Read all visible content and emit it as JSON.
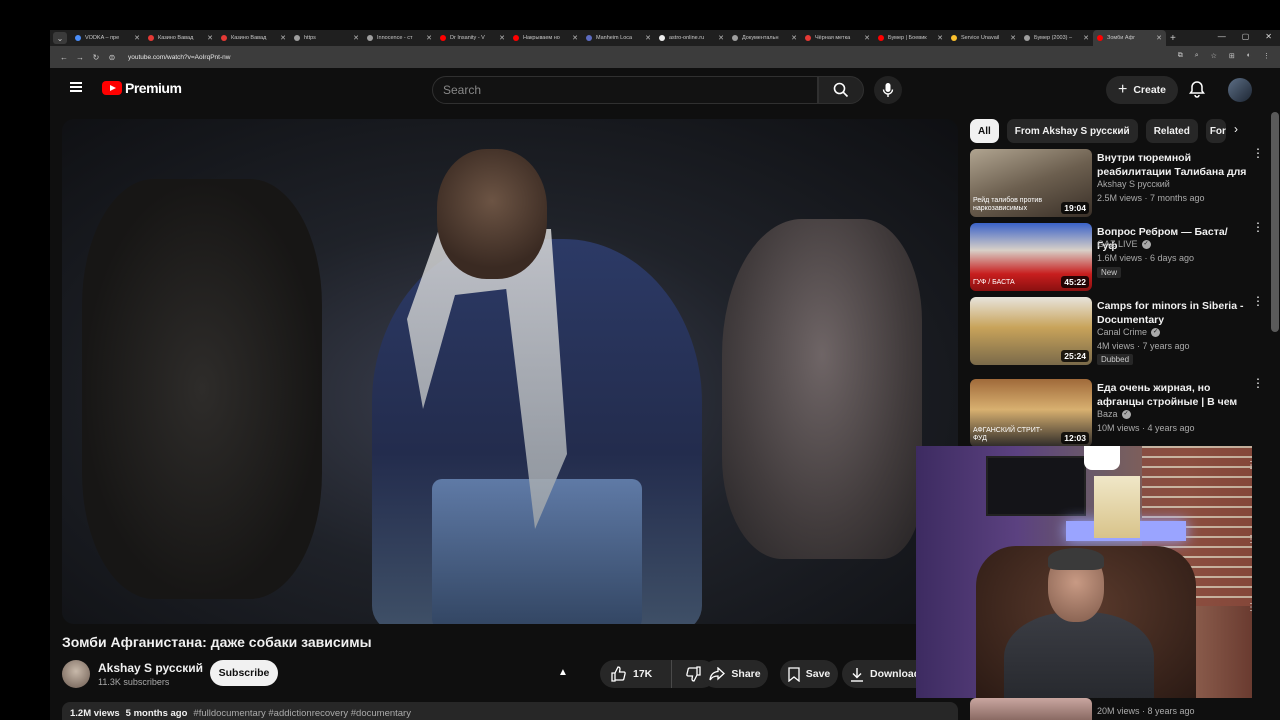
{
  "browser": {
    "tabs": [
      {
        "title": "VODKA – пре",
        "color": "#4a8df8"
      },
      {
        "title": "Казино Вавад",
        "color": "#e53935"
      },
      {
        "title": "Казино Вавад",
        "color": "#e53935"
      },
      {
        "title": "https",
        "color": "#9e9e9e"
      },
      {
        "title": "Innocence - ст",
        "color": "#9e9e9e"
      },
      {
        "title": "Dr Insanity - V",
        "color": "#ff0000"
      },
      {
        "title": "Накрываем но",
        "color": "#ff0000"
      },
      {
        "title": "Manheim Loca",
        "color": "#5c6bc0"
      },
      {
        "title": "astro-online.ru",
        "color": "#eeeeee"
      },
      {
        "title": "Документальн",
        "color": "#9e9e9e"
      },
      {
        "title": "Чёрная метка",
        "color": "#e53935"
      },
      {
        "title": "Бумер | Боевик",
        "color": "#ff0000"
      },
      {
        "title": "Service Unavail",
        "color": "#fbc02d"
      },
      {
        "title": "Бумер (2003) –",
        "color": "#9e9e9e"
      },
      {
        "title": "Зомби Афг",
        "color": "#ff0000"
      }
    ],
    "url": "youtube.com/watch?v=AoIrqPnt-nw"
  },
  "header": {
    "logo_text": "Premium",
    "search_placeholder": "Search",
    "create_label": "Create"
  },
  "video": {
    "title": "Зомби Афганистана: даже собаки зависимы",
    "channel": "Akshay S русский",
    "subscribers": "11.3K subscribers",
    "subscribe_label": "Subscribe",
    "likes": "17K",
    "share_label": "Share",
    "save_label": "Save",
    "download_label": "Download",
    "views": "1.2M views",
    "age": "5 months ago",
    "tags": "#fulldocumentary #addictionrecovery #documentary"
  },
  "chips": [
    "All",
    "From Akshay S русский",
    "Related",
    "For"
  ],
  "recommendations": [
    {
      "title": "Внутри тюремной реабилитации Талибана для ...",
      "channel": "Akshay S русский",
      "verified": false,
      "meta": "2.5M views · 7 months ago",
      "duration": "19:04",
      "thumb_caption": "Рейд талибов против наркозависимых",
      "badge": ""
    },
    {
      "title": "Вопрос Ребром — Баста/Гуф",
      "channel": "GAZ LIVE",
      "verified": true,
      "meta": "1.6M views · 6 days ago",
      "duration": "45:22",
      "thumb_caption": "ГУФ / БАСТА",
      "badge": "New"
    },
    {
      "title": "Camps for minors in Siberia - Documentary",
      "channel": "Canal Crime",
      "verified": true,
      "meta": "4M views · 7 years ago",
      "duration": "25:24",
      "thumb_caption": "",
      "badge": "Dubbed"
    },
    {
      "title": "Еда очень жирная, но афганцы стройные | В чем и...",
      "channel": "Baza",
      "verified": true,
      "meta": "10M views · 4 years ago",
      "duration": "12:03",
      "thumb_caption": "АФГАНСКИЙ СТРИТ-ФУД",
      "badge": ""
    }
  ],
  "partial_rec": {
    "meta": "20M views · 8 years ago"
  }
}
